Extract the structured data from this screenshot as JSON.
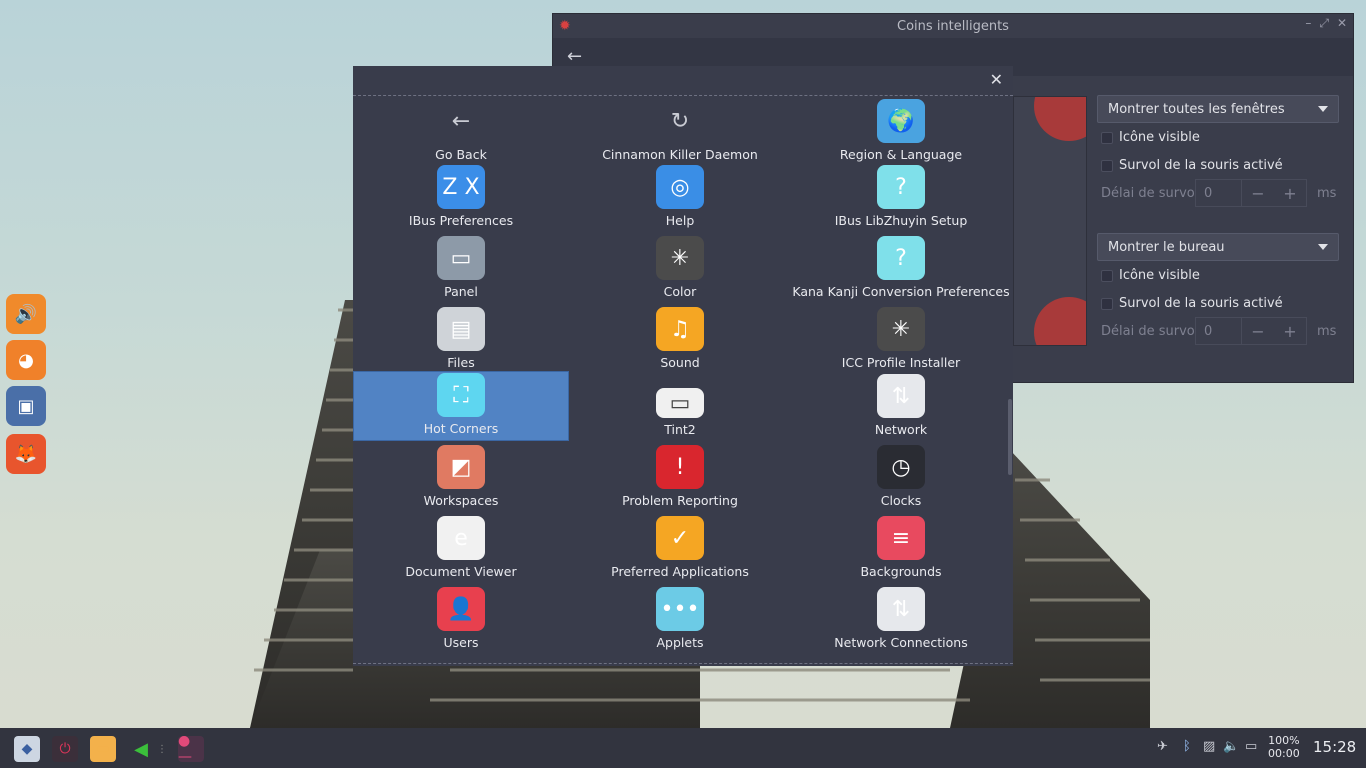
{
  "desktop": {
    "dock": [
      {
        "name": "speaker-icon",
        "color": "#f08a2b"
      },
      {
        "name": "globe-app-icon",
        "color": "#f0812a"
      },
      {
        "name": "media-player-icon",
        "color": "#4a6fa8"
      },
      {
        "name": "firefox-icon",
        "color": "#e8552d"
      }
    ]
  },
  "settings_window": {
    "title": "Coins intelligents",
    "top_left": {
      "action": "Montrer toutes les fenêtres",
      "icon_visible": "Icône visible",
      "hover_enabled": "Survol de la souris activé",
      "hover_delay_label": "Délai de survol",
      "hover_delay_value": "0",
      "unit": "ms"
    },
    "bottom_left": {
      "action": "Montrer le bureau",
      "icon_visible": "Icône visible",
      "hover_enabled": "Survol de la souris activé",
      "hover_delay_label": "Délai de survol",
      "hover_delay_value": "0",
      "unit": "ms"
    },
    "minus": "−",
    "plus": "+"
  },
  "overview": {
    "apps": [
      {
        "label": "Go Back",
        "icon": "back-arrow-icon",
        "color": "transparent",
        "glyph": "←"
      },
      {
        "label": "Cinnamon Killer Daemon",
        "icon": "refresh-icon",
        "color": "transparent",
        "glyph": "↻"
      },
      {
        "label": "Region & Language",
        "icon": "world-map-icon",
        "color": "#4aa3e0",
        "glyph": "🌍"
      },
      {
        "label": "IBus Preferences",
        "icon": "keyboard-keys-icon",
        "color": "#3b8ee8",
        "glyph": "Z X"
      },
      {
        "label": "Help",
        "icon": "lifebuoy-icon",
        "color": "#3a8ee6",
        "glyph": "◎"
      },
      {
        "label": "IBus LibZhuyin Setup",
        "icon": "question-icon",
        "color": "#7fe0ea",
        "glyph": "?"
      },
      {
        "label": "Panel",
        "icon": "panel-icon",
        "color": "#8d9aa8",
        "glyph": "▭"
      },
      {
        "label": "Color",
        "icon": "color-wheel-icon",
        "color": "#4b4b4b",
        "glyph": "✳"
      },
      {
        "label": "Kana Kanji Conversion Preferences",
        "icon": "question-icon",
        "color": "#7fe0ea",
        "glyph": "?"
      },
      {
        "label": "Files",
        "icon": "filing-cabinet-icon",
        "color": "#cfd3d8",
        "glyph": "▤"
      },
      {
        "label": "Sound",
        "icon": "music-note-icon",
        "color": "#f5a623",
        "glyph": "♫"
      },
      {
        "label": "ICC Profile Installer",
        "icon": "color-wheel-icon",
        "color": "#4b4b4b",
        "glyph": "✳"
      },
      {
        "label": "Hot Corners",
        "icon": "hot-corners-icon",
        "color": "#5ed6f0",
        "glyph": "⛶"
      },
      {
        "label": "Tint2",
        "icon": "tint2-bar-icon",
        "color": "transparent",
        "glyph": "▭"
      },
      {
        "label": "Network",
        "icon": "network-arrows-icon",
        "color": "#e6e8ec",
        "glyph": "⇅"
      },
      {
        "label": "Workspaces",
        "icon": "workspaces-icon",
        "color": "#e07a62",
        "glyph": "◩"
      },
      {
        "label": "Problem Reporting",
        "icon": "exclamation-icon",
        "color": "#d9262e",
        "glyph": "!"
      },
      {
        "label": "Clocks",
        "icon": "clock-icon",
        "color": "#2a2c33",
        "glyph": "◷"
      },
      {
        "label": "Document Viewer",
        "icon": "document-viewer-icon",
        "color": "#f1f1f1",
        "glyph": "e"
      },
      {
        "label": "Preferred Applications",
        "icon": "checkmark-icon",
        "color": "#f5a623",
        "glyph": "✓"
      },
      {
        "label": "Backgrounds",
        "icon": "backgrounds-icon",
        "color": "#e84a5f",
        "glyph": "≡"
      },
      {
        "label": "Users",
        "icon": "user-icon",
        "color": "#e8404e",
        "glyph": "👤"
      },
      {
        "label": "Applets",
        "icon": "applets-icon",
        "color": "#6ccbe6",
        "glyph": "•••"
      },
      {
        "label": "Network Connections",
        "icon": "network-connections-icon",
        "color": "#e6e8ec",
        "glyph": "⇅"
      }
    ]
  },
  "taskbar": {
    "battery_percent": "100%",
    "battery_time": "00:00",
    "clock": "15:28"
  }
}
